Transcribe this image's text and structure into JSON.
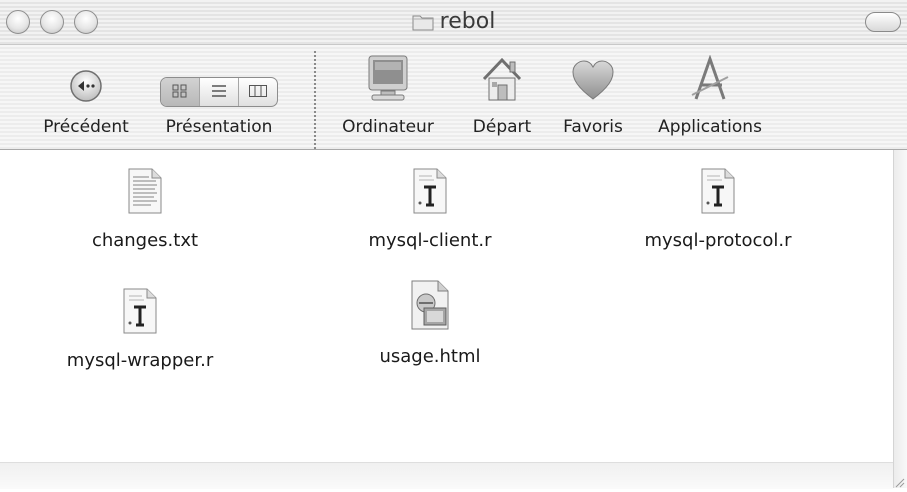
{
  "window": {
    "title": "rebol",
    "title_icon": "folder-icon"
  },
  "toolbar": {
    "back_label": "Précédent",
    "view_label": "Présentation",
    "computer_label": "Ordinateur",
    "home_label": "Départ",
    "favorites_label": "Favoris",
    "applications_label": "Applications",
    "view_selected": "icon"
  },
  "files": [
    {
      "name": "changes.txt",
      "icon": "text-document-icon"
    },
    {
      "name": "mysql-client.r",
      "icon": "rebol-script-icon"
    },
    {
      "name": "mysql-protocol.r",
      "icon": "rebol-script-icon"
    },
    {
      "name": "mysql-wrapper.r",
      "icon": "rebol-script-icon"
    },
    {
      "name": "usage.html",
      "icon": "html-document-icon"
    }
  ]
}
